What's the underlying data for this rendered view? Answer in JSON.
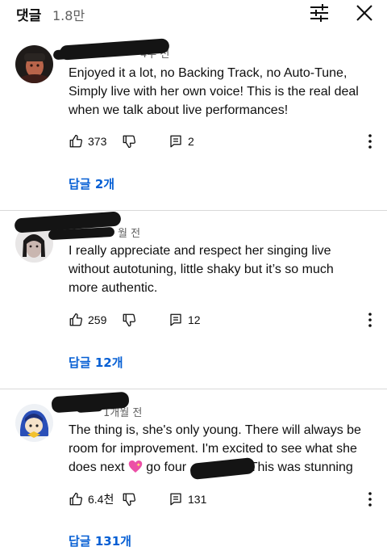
{
  "header": {
    "title": "댓글",
    "count": "1.8만"
  },
  "comments": [
    {
      "meta": "4주 전",
      "lines": [
        "Enjoyed it a lot, no Backing Track, no Auto-Tune,",
        "Simply live with her own voice! This is the real deal",
        "when we talk about live performances!"
      ],
      "likes": "373",
      "reply_count": "2",
      "replies_label": "답글 2개"
    },
    {
      "meta": "월 전",
      "lines": [
        "I really appreciate and respect her singing live",
        "without autotuning, little shaky but it’s so much",
        "more authentic."
      ],
      "likes": "259",
      "reply_count": "12",
      "replies_label": "답글 12개"
    },
    {
      "meta": "1개월 전",
      "lines": [
        "The thing is, she's only young. There will always be",
        "room for improvement. I'm excited to see what she"
      ],
      "line3_a": "does next",
      "line3_b": "go four",
      "line3_c": "This was stunning",
      "likes": "6.4천",
      "reply_count": "131",
      "replies_label": "답글 131개"
    }
  ],
  "icons": [
    "filter-icon",
    "close-icon",
    "thumbs-up-icon",
    "thumbs-down-icon",
    "reply-icon",
    "more-vert-icon",
    "heart-emoji-icon"
  ],
  "colors": {
    "link": "#065fd4",
    "meta": "#606060",
    "divider": "#d9d9d9"
  }
}
